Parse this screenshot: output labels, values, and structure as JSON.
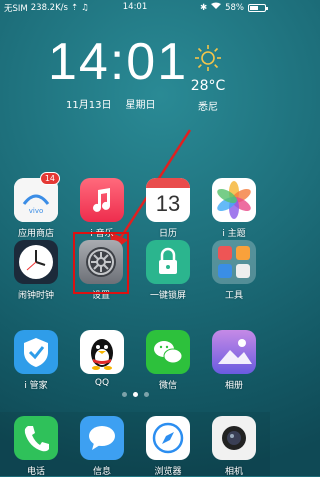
{
  "status_bar": {
    "carrier": "无SIM",
    "speed": "238.2K/s",
    "time": "14:01",
    "battery_pct": "58%",
    "battery_level": 0.58
  },
  "clock_widget": {
    "time": "14:01",
    "date": "11月13日",
    "weekday": "星期日"
  },
  "weather": {
    "temp": "28°C",
    "city": "悉尼",
    "icon": "sun-icon"
  },
  "apps": {
    "row1": [
      {
        "label": "应用商店",
        "icon": "app-store-icon",
        "badge": "14"
      },
      {
        "label": "i 音乐",
        "icon": "music-icon"
      },
      {
        "label": "日历",
        "icon": "calendar-icon",
        "day": "13"
      },
      {
        "label": "i 主题",
        "icon": "theme-icon"
      }
    ],
    "row2": [
      {
        "label": "闹钟时钟",
        "icon": "clock-icon"
      },
      {
        "label": "设置",
        "icon": "settings-gear-icon"
      },
      {
        "label": "一键锁屏",
        "icon": "lock-icon"
      },
      {
        "label": "工具",
        "icon": "tools-folder-icon"
      }
    ],
    "row3": [
      {
        "label": "i 管家",
        "icon": "shield-icon"
      },
      {
        "label": "QQ",
        "icon": "qq-penguin-icon"
      },
      {
        "label": "微信",
        "icon": "wechat-icon"
      },
      {
        "label": "相册",
        "icon": "gallery-icon"
      }
    ]
  },
  "dock": [
    {
      "label": "电话",
      "icon": "phone-icon"
    },
    {
      "label": "信息",
      "icon": "messages-icon"
    },
    {
      "label": "浏览器",
      "icon": "browser-icon"
    },
    {
      "label": "相机",
      "icon": "camera-icon"
    }
  ],
  "page_dots": {
    "count": 3,
    "active": 1
  },
  "colors": {
    "accent_red": "#d11111",
    "wallpaper": "#1d6e7a"
  }
}
